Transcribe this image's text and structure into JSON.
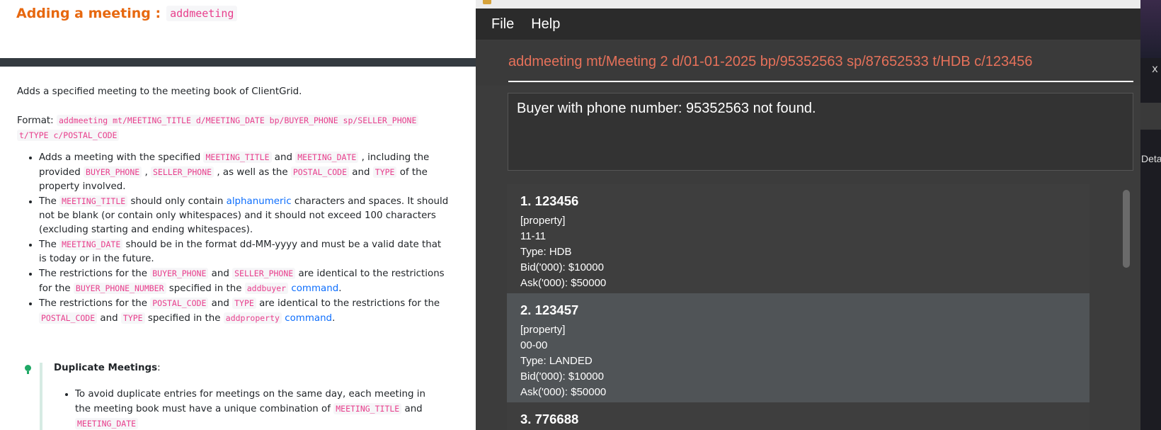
{
  "doc": {
    "title": "Adding a meeting :",
    "title_code": "addmeeting",
    "intro": "Adds a specified meeting to the meeting book of ClientGrid.",
    "format_label": "Format:",
    "format_code_1": "addmeeting mt/MEETING_TITLE d/MEETING_DATE bp/BUYER_PHONE sp/SELLER_PHONE",
    "format_code_2": "t/TYPE c/POSTAL_CODE",
    "bullets": {
      "b1": {
        "t1": "Adds a meeting with the specified ",
        "c1": "MEETING_TITLE",
        "t2": " and ",
        "c2": "MEETING_DATE",
        "t3": " , including the provided ",
        "c3": "BUYER_PHONE",
        "t4": " , ",
        "c4": "SELLER_PHONE",
        "t5": " , as well as the ",
        "c5": "POSTAL_CODE",
        "t6": " and ",
        "c6": "TYPE",
        "t7": " of the property involved."
      },
      "b2": {
        "t1": "The ",
        "c1": "MEETING_TITLE",
        "t2": " should only contain ",
        "link": "alphanumeric",
        "t3": " characters and spaces. It should not be blank (or contain only whitespaces) and it should not exceed 100 characters (excluding starting and ending whitespaces)."
      },
      "b3": {
        "t1": "The ",
        "c1": "MEETING_DATE",
        "t2": " should be in the format dd-MM-yyyy and must be a valid date that is today or in the future."
      },
      "b4": {
        "t1": "The restrictions for the ",
        "c1": "BUYER_PHONE",
        "t2": " and ",
        "c2": "SELLER_PHONE",
        "t3": " are identical to the restrictions for the ",
        "c3": "BUYER_PHONE_NUMBER",
        "t4": " specified in the ",
        "c4": "addbuyer",
        "t5": " ",
        "link": "command",
        "t6": "."
      },
      "b5": {
        "t1": "The restrictions for the ",
        "c1": "POSTAL_CODE",
        "t2": " and ",
        "c2": "TYPE",
        "t3": " are identical to the restrictions for the ",
        "c3": "POSTAL_CODE",
        "t4": " and ",
        "c4": "TYPE",
        "t5": " specified in the ",
        "c5": "addproperty",
        "t6": " ",
        "link": "command",
        "t7": "."
      }
    },
    "tip": {
      "title": "Duplicate Meetings",
      "title_suffix": ":",
      "t1": "To avoid duplicate entries for meetings on the same day, each meeting in the meeting book must have a unique combination of ",
      "c1": "MEETING_TITLE",
      "t2": " and ",
      "c2": "MEETING_DATE"
    }
  },
  "app": {
    "menu": {
      "file": "File",
      "help": "Help"
    },
    "command_value": "addmeeting mt/Meeting 2 d/01-01-2025 bp/95352563 sp/87652533 t/HDB c/123456",
    "result": "Buyer with phone number: 95352563 not found.",
    "colors": {
      "command_text": "#e6715a",
      "selected_card": "#505457",
      "card": "#3e3e3e"
    },
    "properties": [
      {
        "index_postal": "1. 123456",
        "tag": "[property]",
        "unit": "11-11",
        "type": "Type: HDB",
        "bid": "Bid('000): $10000",
        "ask": "Ask('000): $50000"
      },
      {
        "index_postal": "2. 123457",
        "tag": "[property]",
        "unit": "00-00",
        "type": "Type: LANDED",
        "bid": "Bid('000): $10000",
        "ask": "Ask('000): $50000"
      },
      {
        "index_postal": "3. 776688"
      }
    ]
  },
  "background": {
    "x_label": "x",
    "detail_label": "Detail"
  }
}
